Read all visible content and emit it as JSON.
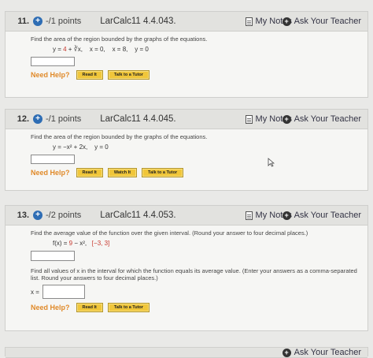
{
  "questions": [
    {
      "number": "11.",
      "points": "-/1 points",
      "code": "LarCalc11 4.4.043.",
      "prompt": "Find the area of the region bounded by the graphs of the equations.",
      "equation": {
        "pre": "y = ",
        "red": "4",
        "post": " + ∛x,    x = 0,    x = 8,    y = 0"
      },
      "buttons": [
        "Read It",
        "Talk to a Tutor"
      ]
    },
    {
      "number": "12.",
      "points": "-/1 points",
      "code": "LarCalc11 4.4.045.",
      "prompt": "Find the area of the region bounded by the graphs of the equations.",
      "equation": {
        "pre": "y = −x² + 2x,    y = 0",
        "red": "",
        "post": ""
      },
      "buttons": [
        "Read It",
        "Watch It",
        "Talk to a Tutor"
      ]
    },
    {
      "number": "13.",
      "points": "-/2 points",
      "code": "LarCalc11 4.4.053.",
      "prompt": "Find the average value of the function over the given interval. (Round your answer to four decimal places.)",
      "equation": {
        "pre": "f(x) = ",
        "red": "9",
        "post": " − x²,   ",
        "red2": "[−3, 3]"
      },
      "prompt2": "Find all values of x in the interval for which the function equals its average value. (Enter your answers as a comma-separated list. Round your answers to four decimal places.)",
      "x_label": "x =",
      "buttons": [
        "Read It",
        "Talk to a Tutor"
      ]
    }
  ],
  "common": {
    "my_notes": "My Notes",
    "ask_teacher": "Ask Your Teacher",
    "need_help": "Need Help?",
    "plus_glyph": "+"
  },
  "colors": {
    "plus_icon": "#2e6db4",
    "need_help": "#e08a2a",
    "button_bg": "#f0c63a",
    "equation_red": "#c7362c"
  }
}
